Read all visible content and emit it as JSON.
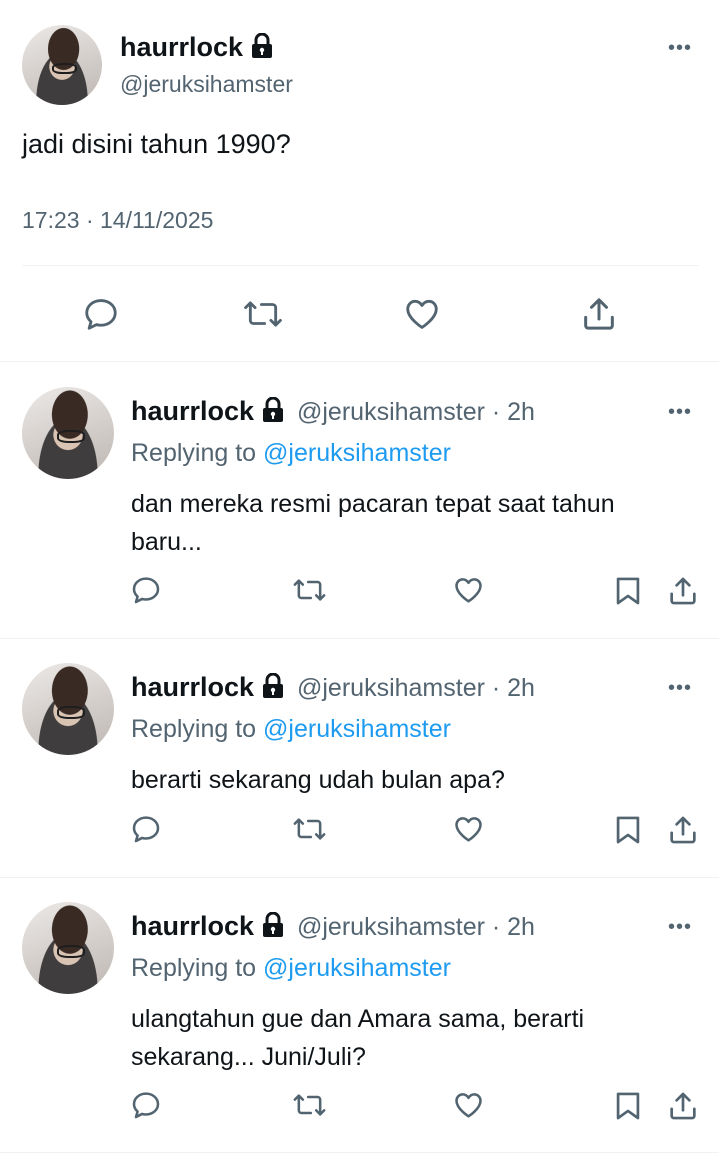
{
  "main_tweet": {
    "display_name": "haurrlock",
    "handle": "@jeruksihamster",
    "text": "jadi disini tahun 1990?",
    "timestamp": "17:23 · 14/11/2025",
    "icons": [
      "reply-icon",
      "retweet-icon",
      "like-icon",
      "share-icon"
    ]
  },
  "replies": [
    {
      "display_name": "haurrlock",
      "handle": "@jeruksihamster",
      "time": "2h",
      "replying_label": "Replying to",
      "replying_handle": "@jeruksihamster",
      "text_lines": [
        "dan mereka resmi pacaran tepat saat tahun",
        "baru..."
      ]
    },
    {
      "display_name": "haurrlock",
      "handle": "@jeruksihamster",
      "time": "2h",
      "replying_label": "Replying to",
      "replying_handle": "@jeruksihamster",
      "text_lines": [
        "berarti sekarang udah bulan apa?"
      ]
    },
    {
      "display_name": "haurrlock",
      "handle": "@jeruksihamster",
      "time": "2h",
      "replying_label": "Replying to",
      "replying_handle": "@jeruksihamster",
      "text_lines": [
        "ulangtahun gue dan Amara sama, berarti",
        "sekarang... Juni/Juli?"
      ]
    }
  ],
  "colors": {
    "text": "#0f1419",
    "muted": "#536471",
    "link": "#1d9bf0",
    "divider": "#eff3f4"
  }
}
